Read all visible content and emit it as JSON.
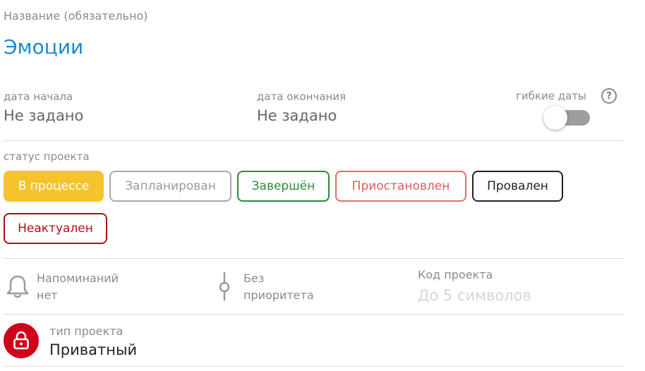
{
  "name": {
    "label": "Название (обязательно)",
    "value": "Эмоции"
  },
  "dates": {
    "start_label": "дата начала",
    "start_value": "Не задано",
    "end_label": "дата окончания",
    "end_value": "Не задано",
    "flexible_label": "гибкие даты",
    "flexible_enabled": false,
    "help_icon": "question-circle-icon"
  },
  "status": {
    "label": "статус проекта",
    "options": [
      {
        "label": "В процессе",
        "selected": true,
        "color": "#f5c32c"
      },
      {
        "label": "Запланирован",
        "selected": false,
        "color": "#a8a8a8"
      },
      {
        "label": "Завершён",
        "selected": false,
        "color": "#2e8b3a"
      },
      {
        "label": "Приостановлен",
        "selected": false,
        "color": "#e86a6a"
      },
      {
        "label": "Провален",
        "selected": false,
        "color": "#222222"
      },
      {
        "label": "Неактуален",
        "selected": false,
        "color": "#b01010"
      }
    ]
  },
  "reminders": {
    "icon": "bell-icon",
    "line1": "Напоминаний",
    "line2": "нет"
  },
  "priority": {
    "icon": "priority-icon",
    "line1": "Без",
    "line2": "приоритета"
  },
  "project_code": {
    "label": "Код проекта",
    "placeholder": "До 5 символов"
  },
  "project_type": {
    "icon": "lock-icon",
    "label": "тип проекта",
    "value": "Приватный",
    "icon_bg": "#d0021b"
  }
}
